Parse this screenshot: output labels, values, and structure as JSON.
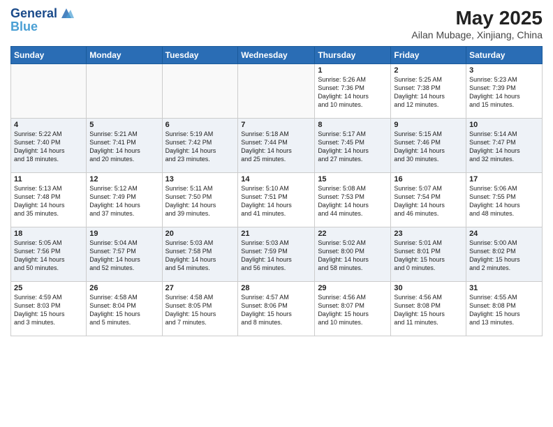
{
  "logo": {
    "line1": "General",
    "line2": "Blue"
  },
  "title": "May 2025",
  "subtitle": "Ailan Mubage, Xinjiang, China",
  "weekdays": [
    "Sunday",
    "Monday",
    "Tuesday",
    "Wednesday",
    "Thursday",
    "Friday",
    "Saturday"
  ],
  "weeks": [
    [
      {
        "day": "",
        "info": ""
      },
      {
        "day": "",
        "info": ""
      },
      {
        "day": "",
        "info": ""
      },
      {
        "day": "",
        "info": ""
      },
      {
        "day": "1",
        "info": "Sunrise: 5:26 AM\nSunset: 7:36 PM\nDaylight: 14 hours\nand 10 minutes."
      },
      {
        "day": "2",
        "info": "Sunrise: 5:25 AM\nSunset: 7:38 PM\nDaylight: 14 hours\nand 12 minutes."
      },
      {
        "day": "3",
        "info": "Sunrise: 5:23 AM\nSunset: 7:39 PM\nDaylight: 14 hours\nand 15 minutes."
      }
    ],
    [
      {
        "day": "4",
        "info": "Sunrise: 5:22 AM\nSunset: 7:40 PM\nDaylight: 14 hours\nand 18 minutes."
      },
      {
        "day": "5",
        "info": "Sunrise: 5:21 AM\nSunset: 7:41 PM\nDaylight: 14 hours\nand 20 minutes."
      },
      {
        "day": "6",
        "info": "Sunrise: 5:19 AM\nSunset: 7:42 PM\nDaylight: 14 hours\nand 23 minutes."
      },
      {
        "day": "7",
        "info": "Sunrise: 5:18 AM\nSunset: 7:44 PM\nDaylight: 14 hours\nand 25 minutes."
      },
      {
        "day": "8",
        "info": "Sunrise: 5:17 AM\nSunset: 7:45 PM\nDaylight: 14 hours\nand 27 minutes."
      },
      {
        "day": "9",
        "info": "Sunrise: 5:15 AM\nSunset: 7:46 PM\nDaylight: 14 hours\nand 30 minutes."
      },
      {
        "day": "10",
        "info": "Sunrise: 5:14 AM\nSunset: 7:47 PM\nDaylight: 14 hours\nand 32 minutes."
      }
    ],
    [
      {
        "day": "11",
        "info": "Sunrise: 5:13 AM\nSunset: 7:48 PM\nDaylight: 14 hours\nand 35 minutes."
      },
      {
        "day": "12",
        "info": "Sunrise: 5:12 AM\nSunset: 7:49 PM\nDaylight: 14 hours\nand 37 minutes."
      },
      {
        "day": "13",
        "info": "Sunrise: 5:11 AM\nSunset: 7:50 PM\nDaylight: 14 hours\nand 39 minutes."
      },
      {
        "day": "14",
        "info": "Sunrise: 5:10 AM\nSunset: 7:51 PM\nDaylight: 14 hours\nand 41 minutes."
      },
      {
        "day": "15",
        "info": "Sunrise: 5:08 AM\nSunset: 7:53 PM\nDaylight: 14 hours\nand 44 minutes."
      },
      {
        "day": "16",
        "info": "Sunrise: 5:07 AM\nSunset: 7:54 PM\nDaylight: 14 hours\nand 46 minutes."
      },
      {
        "day": "17",
        "info": "Sunrise: 5:06 AM\nSunset: 7:55 PM\nDaylight: 14 hours\nand 48 minutes."
      }
    ],
    [
      {
        "day": "18",
        "info": "Sunrise: 5:05 AM\nSunset: 7:56 PM\nDaylight: 14 hours\nand 50 minutes."
      },
      {
        "day": "19",
        "info": "Sunrise: 5:04 AM\nSunset: 7:57 PM\nDaylight: 14 hours\nand 52 minutes."
      },
      {
        "day": "20",
        "info": "Sunrise: 5:03 AM\nSunset: 7:58 PM\nDaylight: 14 hours\nand 54 minutes."
      },
      {
        "day": "21",
        "info": "Sunrise: 5:03 AM\nSunset: 7:59 PM\nDaylight: 14 hours\nand 56 minutes."
      },
      {
        "day": "22",
        "info": "Sunrise: 5:02 AM\nSunset: 8:00 PM\nDaylight: 14 hours\nand 58 minutes."
      },
      {
        "day": "23",
        "info": "Sunrise: 5:01 AM\nSunset: 8:01 PM\nDaylight: 15 hours\nand 0 minutes."
      },
      {
        "day": "24",
        "info": "Sunrise: 5:00 AM\nSunset: 8:02 PM\nDaylight: 15 hours\nand 2 minutes."
      }
    ],
    [
      {
        "day": "25",
        "info": "Sunrise: 4:59 AM\nSunset: 8:03 PM\nDaylight: 15 hours\nand 3 minutes."
      },
      {
        "day": "26",
        "info": "Sunrise: 4:58 AM\nSunset: 8:04 PM\nDaylight: 15 hours\nand 5 minutes."
      },
      {
        "day": "27",
        "info": "Sunrise: 4:58 AM\nSunset: 8:05 PM\nDaylight: 15 hours\nand 7 minutes."
      },
      {
        "day": "28",
        "info": "Sunrise: 4:57 AM\nSunset: 8:06 PM\nDaylight: 15 hours\nand 8 minutes."
      },
      {
        "day": "29",
        "info": "Sunrise: 4:56 AM\nSunset: 8:07 PM\nDaylight: 15 hours\nand 10 minutes."
      },
      {
        "day": "30",
        "info": "Sunrise: 4:56 AM\nSunset: 8:08 PM\nDaylight: 15 hours\nand 11 minutes."
      },
      {
        "day": "31",
        "info": "Sunrise: 4:55 AM\nSunset: 8:08 PM\nDaylight: 15 hours\nand 13 minutes."
      }
    ]
  ]
}
